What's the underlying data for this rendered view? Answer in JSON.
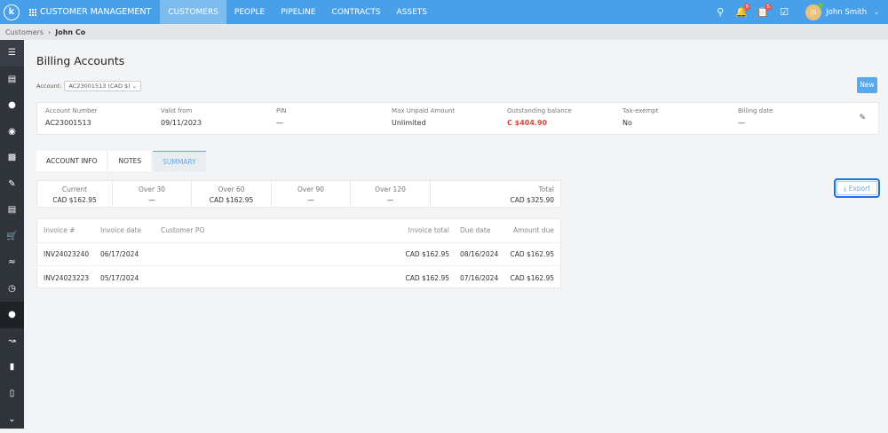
{
  "topbar": {
    "logo": "k",
    "app_title": "CUSTOMER MANAGEMENT",
    "nav": [
      "CUSTOMERS",
      "PEOPLE",
      "PIPELINE",
      "CONTRACTS",
      "ASSETS"
    ],
    "active_nav": "CUSTOMERS",
    "notifications_count": "9",
    "tasks_count": "5",
    "user_initials": "JS",
    "user_name": "John Smith"
  },
  "breadcrumb": {
    "parent": "Customers",
    "current": "John Co"
  },
  "sidebar": {
    "icons": [
      "menu-icon",
      "dashboard-icon",
      "person-icon",
      "location-icon",
      "contact-card-icon",
      "clipboard-icon",
      "chat-icon",
      "cart-icon",
      "handshake-icon",
      "billing-clock-icon",
      "dollar-icon",
      "chart-icon",
      "ticket-icon",
      "folder-user-icon",
      "more-chevron-icon"
    ],
    "active": "dollar-icon"
  },
  "page": {
    "title": "Billing Accounts",
    "account_label": "Account:",
    "account_value": "AC23001513 (CAD $)",
    "new_label": "New",
    "export_label": "Export"
  },
  "info": [
    {
      "label": "Account Number",
      "value": "AC23001513"
    },
    {
      "label": "Valid from",
      "value": "09/11/2023"
    },
    {
      "label": "PIN",
      "value": "—"
    },
    {
      "label": "Max Unpaid Amount",
      "value": "Unlimited"
    },
    {
      "label": "Outstanding balance",
      "value": "C $404.90"
    },
    {
      "label": "Tax-exempt",
      "value": "No"
    },
    {
      "label": "Billing date",
      "value": "—"
    }
  ],
  "tabs": [
    "ACCOUNT INFO",
    "NOTES",
    "SUMMARY"
  ],
  "aging": [
    {
      "label": "Current",
      "value": "CAD $162.95"
    },
    {
      "label": "Over 30",
      "value": "—"
    },
    {
      "label": "Over 60",
      "value": "CAD $162.95"
    },
    {
      "label": "Over 90",
      "value": "—"
    },
    {
      "label": "Over 120",
      "value": "—"
    },
    {
      "label": "Total",
      "value": "CAD $325.90"
    }
  ],
  "invoices": {
    "headers": [
      "Invoice #",
      "Invoice date",
      "Customer PO",
      "Invoice total",
      "Due date",
      "Amount due"
    ],
    "rows": [
      [
        "INV24023240",
        "06/17/2024",
        "",
        "CAD $162.95",
        "08/16/2024",
        "CAD $162.95"
      ],
      [
        "INV24023223",
        "05/17/2024",
        "",
        "CAD $162.95",
        "07/16/2024",
        "CAD $162.95"
      ]
    ]
  },
  "colors": {
    "brand": "#4aa0e8",
    "sidebar": "#2f333a",
    "negative": "#e0473c"
  }
}
